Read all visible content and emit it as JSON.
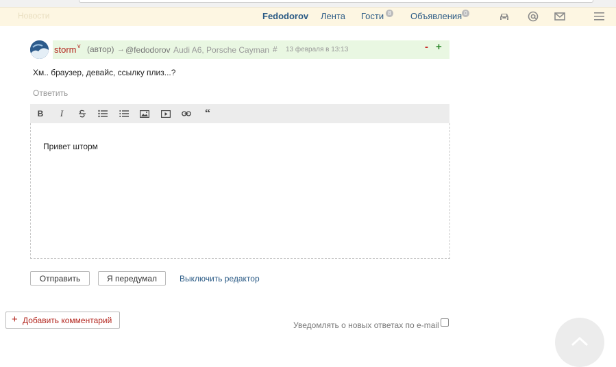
{
  "nav": {
    "faded_text": "Новости",
    "user": "Fedodorov",
    "feed": "Лента",
    "guests": "Гости",
    "guests_count": "8",
    "ads": "Объявления",
    "ads_count": "0",
    "icons": [
      "car-icon",
      "at-icon",
      "mail-icon",
      "menu-icon"
    ]
  },
  "comment": {
    "author": "storm",
    "verified_mark": "v",
    "role": "(автор)",
    "arrow": "→",
    "mention": "@fedodorov",
    "cars": "Audi A6, Porsche Cayman",
    "hash": "#",
    "date": "13 февраля в 13:13",
    "vote_minus": "-",
    "vote_plus": "+",
    "text": "Хм.. браузер, девайс, ссылку плиз...?",
    "reply": "Ответить"
  },
  "editor": {
    "tools": [
      "bold",
      "italic",
      "strikethrough",
      "bullet-list",
      "numbered-list",
      "image",
      "video",
      "link",
      "quote"
    ],
    "bold_label": "B",
    "italic_label": "I",
    "quote_label": "“",
    "content": "Привет шторм"
  },
  "actions": {
    "send": "Отправить",
    "cancel": "Я передумал",
    "disable_editor": "Выключить редактор"
  },
  "footer": {
    "add_comment": "Добавить комментарий",
    "notify": "Уведомлять о новых ответах по e-mail"
  },
  "colors": {
    "nav_bg": "#fdf6e2",
    "link": "#2a5a85",
    "author": "#b3261e",
    "header_bg": "#e9f7e2",
    "plus": "#2f8a2f",
    "minus": "#c82424"
  }
}
